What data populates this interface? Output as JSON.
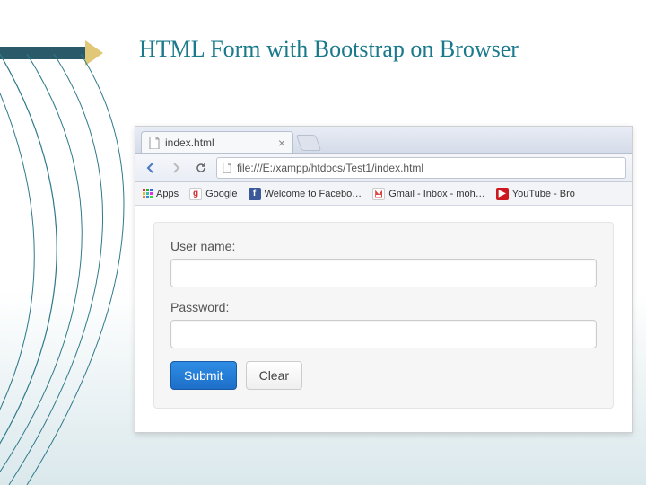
{
  "slide": {
    "title": "HTML Form with Bootstrap on Browser"
  },
  "browser": {
    "tab": {
      "title": "index.html"
    },
    "url": "file:///E:/xampp/htdocs/Test1/index.html",
    "bookmarks": {
      "apps": "Apps",
      "google": "Google",
      "facebook": "Welcome to Facebo…",
      "gmail": "Gmail - Inbox - moh…",
      "youtube": "YouTube - Bro"
    }
  },
  "form": {
    "username_label": "User name:",
    "password_label": "Password:",
    "submit_label": "Submit",
    "clear_label": "Clear"
  }
}
